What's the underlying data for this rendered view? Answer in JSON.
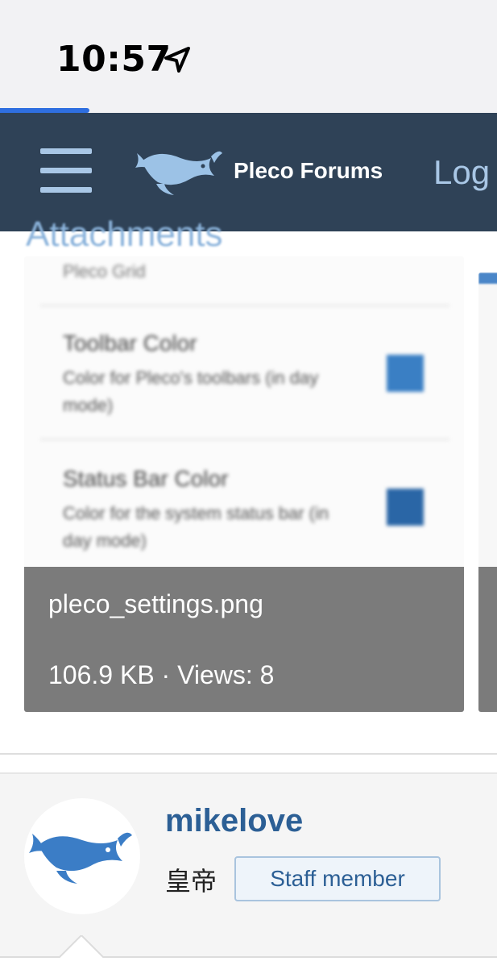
{
  "status_bar": {
    "time": "10:57",
    "location_icon": "location-arrow-icon",
    "loading_progress": 0.18
  },
  "nav": {
    "menu_icon": "hamburger-icon",
    "logo_icon": "pleco-fish-logo",
    "brand": "Pleco Forums",
    "login_label": "Log"
  },
  "attachments": {
    "heading": "Attachments",
    "items": [
      {
        "filename": "pleco_settings.png",
        "meta": "106.9 KB · Views: 8",
        "preview": {
          "top_cut": "Pleco Grid",
          "rows": [
            {
              "title": "Toolbar Color",
              "desc": "Color for Pleco's toolbars (in day mode)",
              "swatch": "#3a7fc4"
            },
            {
              "title": "Status Bar Color",
              "desc": "Color for the system status bar (in day mode)",
              "swatch": "#2a66a6"
            }
          ]
        }
      }
    ]
  },
  "author": {
    "avatar_icon": "pleco-fish-avatar",
    "username": "mikelove",
    "title": "皇帝",
    "badge": "Staff member"
  },
  "colors": {
    "nav_bg": "#2f4257",
    "accent": "#2c5f95",
    "progress": "#2f6fe0"
  }
}
